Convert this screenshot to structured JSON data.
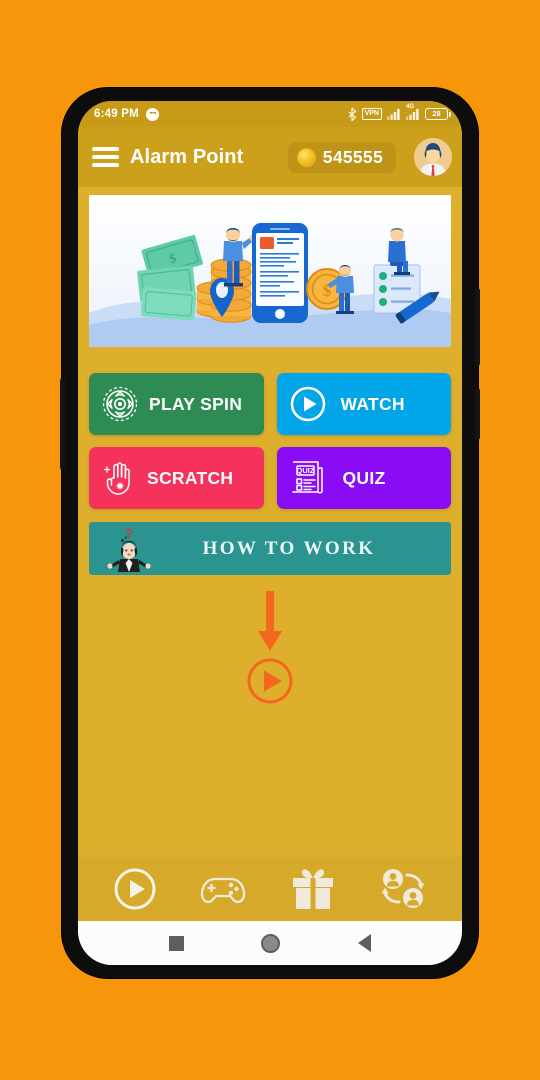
{
  "status_bar": {
    "time": "6:49 PM",
    "messenger_icon": "messenger-icon",
    "bluetooth_icon": "bluetooth-icon",
    "vpn_label": "VPN",
    "signal_icon_1": "signal-bars-icon",
    "network_label": "4G",
    "signal_icon_2": "signal-bars-4g-icon",
    "battery_level": "28"
  },
  "app_bar": {
    "menu_icon": "hamburger-menu-icon",
    "title": "Alarm Point",
    "coin_icon": "coin-icon",
    "coin_balance": "545555",
    "avatar_icon": "user-avatar"
  },
  "banner": {
    "name": "promo-illustration-banner",
    "alt": "money coins smartphone earnings illustration"
  },
  "actions": [
    {
      "id": "play-spin",
      "label": "PLAY SPIN",
      "icon": "spin-wheel-icon",
      "color": "#2E8B53"
    },
    {
      "id": "watch",
      "label": "WATCH",
      "icon": "play-circle-icon",
      "color": "#02A5E8"
    },
    {
      "id": "scratch",
      "label": "SCRATCH",
      "icon": "scratch-hand-icon",
      "color": "#F5325B"
    },
    {
      "id": "quiz",
      "label": "QUIZ",
      "icon": "quiz-paper-icon",
      "color": "#8A0CF5"
    }
  ],
  "how_to_work": {
    "label": "HOW  TO  WORK",
    "icon": "confused-person-icon",
    "color": "#2C9490"
  },
  "hint": {
    "arrow_icon": "down-arrow-icon",
    "play_icon": "play-circle-outline-icon",
    "color": "#F4671E"
  },
  "bottom_nav": [
    {
      "id": "video",
      "icon": "play-circle-icon"
    },
    {
      "id": "games",
      "icon": "game-controller-icon"
    },
    {
      "id": "rewards",
      "icon": "gift-box-icon"
    },
    {
      "id": "referral",
      "icon": "refer-friends-icon"
    }
  ],
  "android_nav": [
    {
      "id": "recents",
      "icon": "square-recents-icon"
    },
    {
      "id": "home",
      "icon": "circle-home-icon"
    },
    {
      "id": "back",
      "icon": "triangle-back-icon"
    }
  ],
  "theme": {
    "page_background": "#F7960A",
    "screen_background": "#DDAF2C",
    "app_bar": "#CDA01C",
    "status_bar": "#C79A17",
    "bottom_nav": "#D6A92A"
  }
}
